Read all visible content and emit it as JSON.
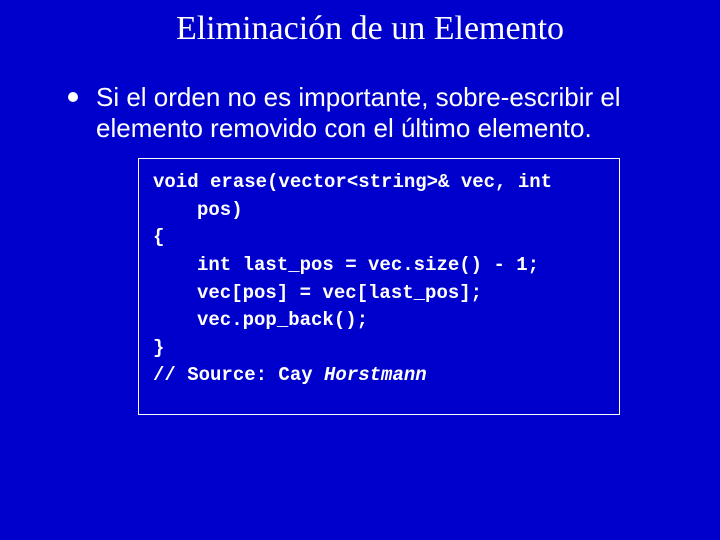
{
  "slide": {
    "title": "Eliminación de un Elemento",
    "bullet": "Si el orden no es importante, sobre-escribir el elemento removido con el último elemento.",
    "code": {
      "l1": "void erase(vector<string>& vec, int",
      "l1b": "pos)",
      "l2": "{",
      "l3": "int last_pos = vec.size() - 1;",
      "l4": "vec[pos] = vec[last_pos];",
      "l5": "vec.pop_back();",
      "l6": "}",
      "l7a": "// Source: Cay ",
      "l7b": "Horstmann"
    }
  }
}
